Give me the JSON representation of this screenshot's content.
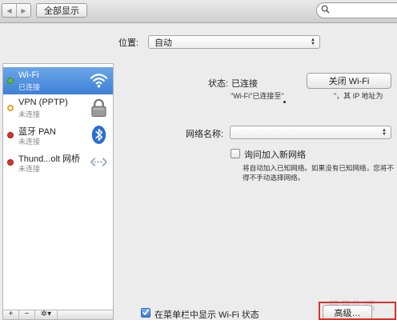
{
  "toolbar": {
    "back_label": "◀",
    "forward_label": "▶",
    "show_all_label": "全部显示",
    "search_placeholder": ""
  },
  "location": {
    "label": "位置:",
    "value": "自动"
  },
  "services": [
    {
      "name": "Wi-Fi",
      "status": "已连接",
      "dot_color": "#5bbf3c",
      "icon": "wifi-icon",
      "selected": true
    },
    {
      "name": "VPN (PPTP)",
      "status": "未连接",
      "dot_color": "#f0a020",
      "icon": "lock-icon",
      "selected": false
    },
    {
      "name": "蓝牙 PAN",
      "status": "未连接",
      "dot_color": "#d9332b",
      "icon": "bluetooth-icon",
      "selected": false
    },
    {
      "name": "Thund...olt 网桥",
      "status": "未连接",
      "dot_color": "#d9332b",
      "icon": "thunderbolt-bridge-icon",
      "selected": false
    }
  ],
  "sidebar_buttons": {
    "add": "+",
    "remove": "−",
    "gear": "✲▾"
  },
  "detail": {
    "status_label": "状态:",
    "status_value": "已连接",
    "wifi_off_button": "关闭 Wi-Fi",
    "status_desc_left": "\"Wi-Fi\"已连接至\"",
    "status_desc_right": "\"，其 IP 地址为",
    "network_name_label": "网络名称:",
    "network_name_value": "",
    "ask_join_label": "询问加入新网络",
    "ask_join_help": "将自动加入已知网络。如果没有已知网络，您将不得不手动选择网络。",
    "show_in_menubar_label": "在菜单栏中显示 Wi-Fi 状态",
    "show_in_menubar_checked": true,
    "advanced_button": "高级…"
  },
  "watermark_text": "健易生活",
  "colors": {
    "selection": "#3f80d6",
    "highlight_box": "#e0302a"
  }
}
